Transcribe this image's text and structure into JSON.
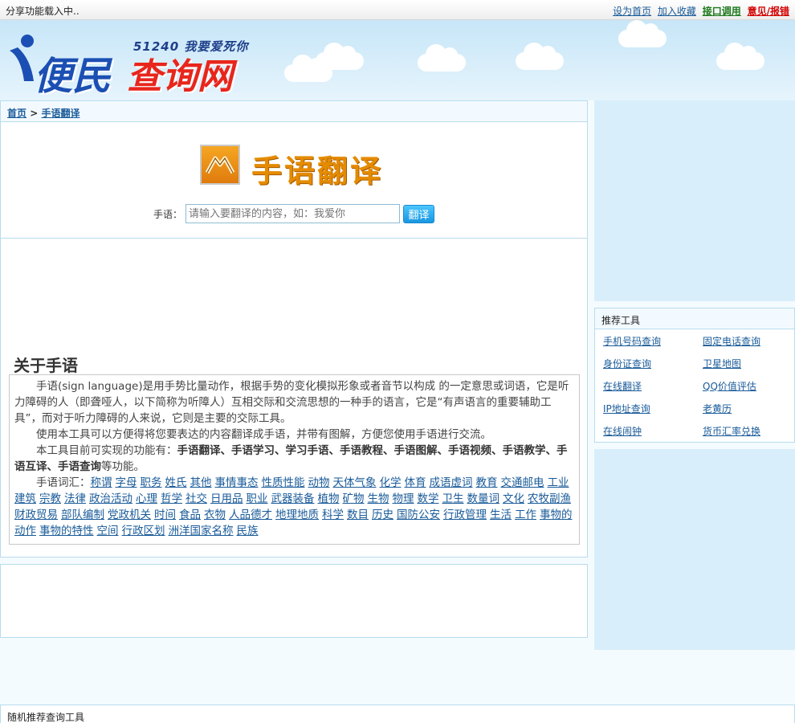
{
  "topbar": {
    "loading": "分享功能载入中..",
    "links": [
      "设为首页",
      "加入收藏",
      "接口调用",
      "意见/报错"
    ]
  },
  "logo": {
    "slogan": "51240 我要爱死你",
    "name_part1": "便民",
    "name_part2": "查询网"
  },
  "breadcrumb": {
    "home": "首页",
    "sep": ">",
    "current": "手语翻译"
  },
  "tool": {
    "title": "手语翻译",
    "label": "手语：",
    "placeholder": "请输入要翻译的内容，如：我爱你",
    "button": "翻译"
  },
  "about": {
    "title": "关于手语",
    "p1": "手语(sign language)是用手势比量动作，根据手势的变化模拟形象或者音节以构成 的一定意思或词语，它是听力障碍的人（即聋哑人，以下简称为听障人）互相交际和交流思想的一种手的语言，它是“有声语言的重要辅助工具”，而对于听力障碍的人来说，它则是主要的交际工具。",
    "p2": "使用本工具可以方便得将您要表达的内容翻译成手语，并带有图解，方便您使用手语进行交流。",
    "p3_prefix": "本工具目前可实现的功能有：",
    "p3_features": "手语翻译、手语学习、学习手语、手语教程、手语图解、手语视频、手语教学、手语互译、手语查询",
    "p3_suffix": "等功能。",
    "vocab_label": "手语词汇：",
    "vocab": [
      "称谓",
      "字母",
      "职务",
      "姓氏",
      "其他",
      "事情事态",
      "性质性能",
      "动物",
      "天体气象",
      "化学",
      "体育",
      "成语虚词",
      "教育",
      "交通邮电",
      "工业建筑",
      "宗教",
      "法律",
      "政治活动",
      "心理",
      "哲学",
      "社交",
      "日用品",
      "职业",
      "武器装备",
      "植物",
      "矿物",
      "生物",
      "物理",
      "数学",
      "卫生",
      "数量词",
      "文化",
      "农牧副渔",
      "财政贸易",
      "部队编制",
      "党政机关",
      "时间",
      "食品",
      "衣物",
      "人品德才",
      "地理地质",
      "科学",
      "数目",
      "历史",
      "国防公安",
      "行政管理",
      "生活",
      "工作",
      "事物的动作",
      "事物的特性",
      "空间",
      "行政区划",
      "洲洋国家名称",
      "民族"
    ]
  },
  "recommend": {
    "title": "推荐工具",
    "items": [
      "手机号码查询",
      "固定电话查询",
      "身份证查询",
      "卫星地图",
      "在线翻译",
      "QQ价值评估",
      "IP地址查询",
      "老黄历",
      "在线闹钟",
      "货币汇率兑换"
    ]
  },
  "random": {
    "title": "随机推荐查询工具"
  }
}
